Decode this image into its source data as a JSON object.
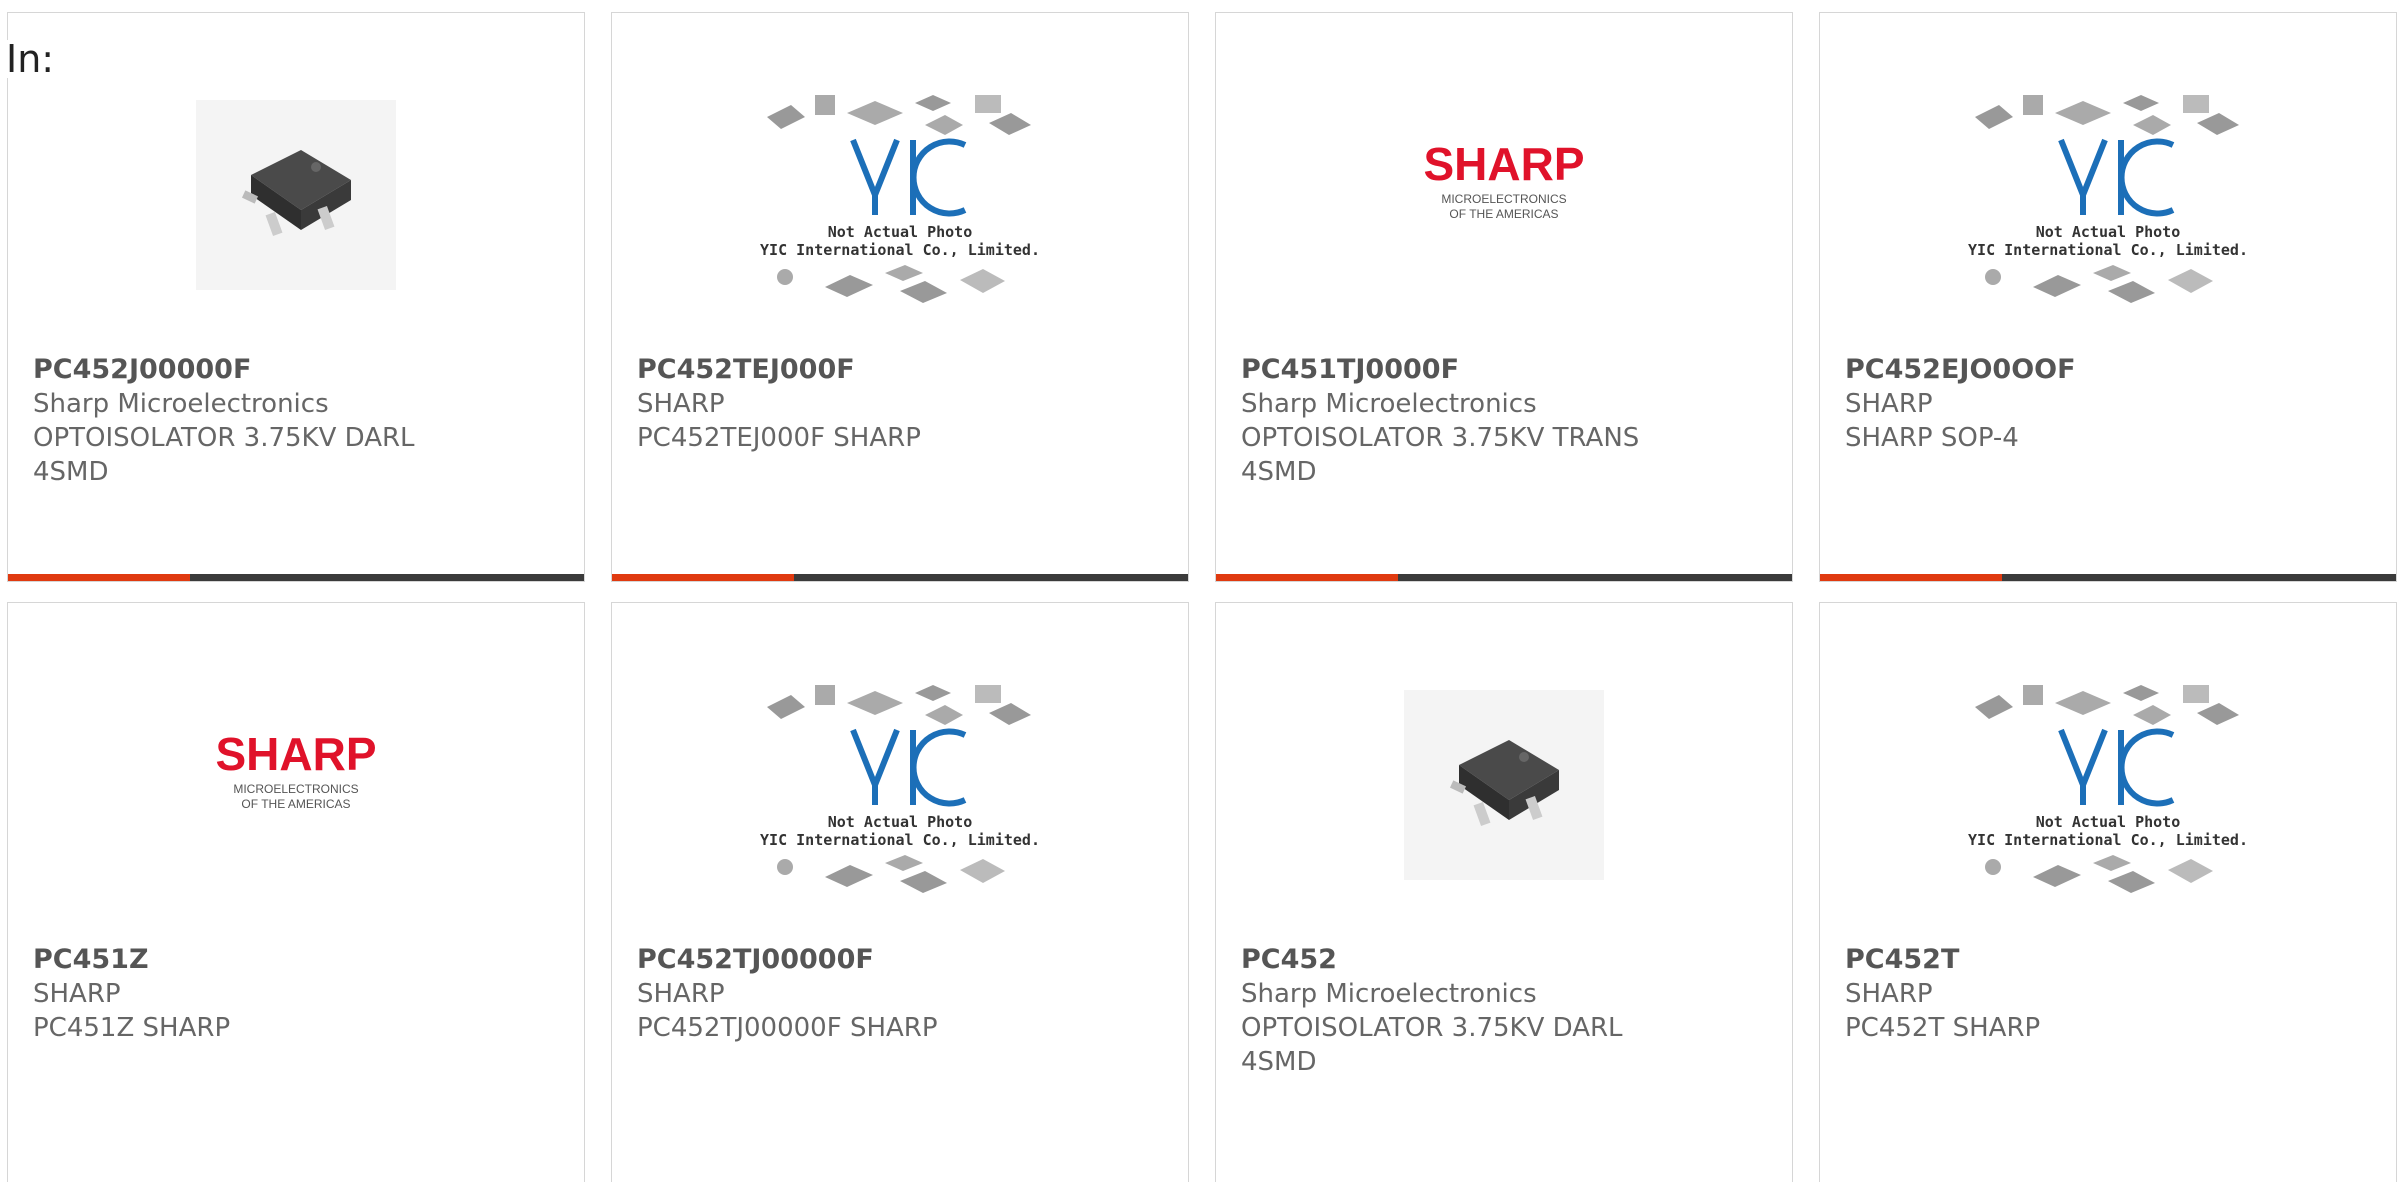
{
  "heading": "In:",
  "accent_color": "#e03a10",
  "bar_color": "#3b3b3b",
  "cards": [
    {
      "part_number": "PC452J00000F",
      "manufacturer": "Sharp Microelectronics",
      "description": "OPTOISOLATOR 3.75KV DARL 4SMD",
      "image": "chip-photo"
    },
    {
      "part_number": "PC452TEJ000F",
      "manufacturer": "SHARP",
      "description": "PC452TEJ000F SHARP",
      "image": "yic-placeholder",
      "placeholder_line1": "Not Actual Photo",
      "placeholder_line2": "YIC International Co., Limited."
    },
    {
      "part_number": "PC451TJ0000F",
      "manufacturer": "Sharp Microelectronics",
      "description": "OPTOISOLATOR 3.75KV TRANS 4SMD",
      "image": "sharp-logo",
      "logo_text": "SHARP",
      "logo_sub1": "MICROELECTRONICS",
      "logo_sub2": "OF THE AMERICAS"
    },
    {
      "part_number": "PC452EJO0OOF",
      "manufacturer": "SHARP",
      "description": "SHARP SOP-4",
      "image": "yic-placeholder",
      "placeholder_line1": "Not Actual Photo",
      "placeholder_line2": "YIC International Co., Limited."
    },
    {
      "part_number": "PC451Z",
      "manufacturer": "SHARP",
      "description": "PC451Z SHARP",
      "image": "sharp-logo",
      "logo_text": "SHARP",
      "logo_sub1": "MICROELECTRONICS",
      "logo_sub2": "OF THE AMERICAS"
    },
    {
      "part_number": "PC452TJ00000F",
      "manufacturer": "SHARP",
      "description": "PC452TJ00000F SHARP",
      "image": "yic-placeholder",
      "placeholder_line1": "Not Actual Photo",
      "placeholder_line2": "YIC International Co., Limited."
    },
    {
      "part_number": "PC452",
      "manufacturer": "Sharp Microelectronics",
      "description": "OPTOISOLATOR 3.75KV DARL 4SMD",
      "image": "chip-photo"
    },
    {
      "part_number": "PC452T",
      "manufacturer": "SHARP",
      "description": "PC452T SHARP",
      "image": "yic-placeholder",
      "placeholder_line1": "Not Actual Photo",
      "placeholder_line2": "YIC International Co., Limited."
    }
  ]
}
